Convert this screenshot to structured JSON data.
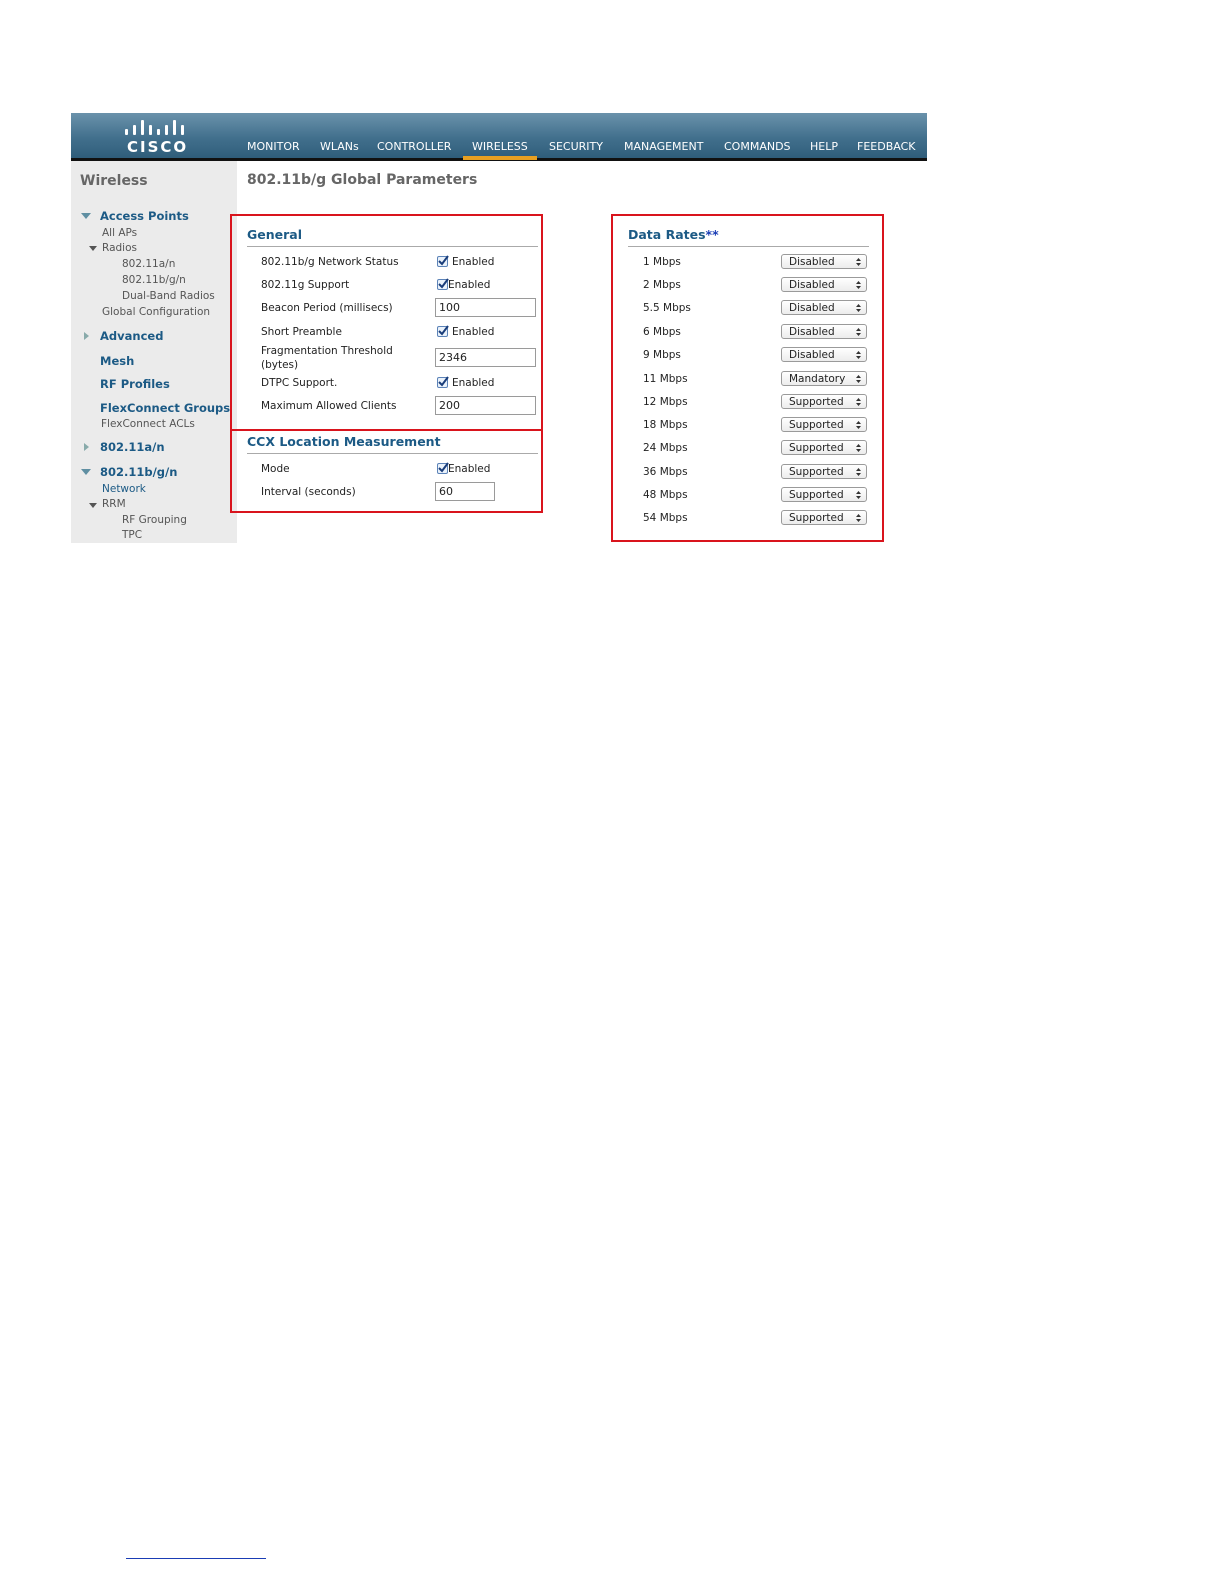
{
  "header": {
    "logo_text": "CISCO",
    "nav": [
      "MONITOR",
      "WLANs",
      "CONTROLLER",
      "WIRELESS",
      "SECURITY",
      "MANAGEMENT",
      "COMMANDS",
      "HELP",
      "FEEDBACK"
    ],
    "active_nav": "WIRELESS",
    "accent_color": "#e8a021"
  },
  "sidebar": {
    "title": "Wireless",
    "access_points": "Access Points",
    "all_aps": "All APs",
    "radios": "Radios",
    "radio_80211an": "802.11a/n",
    "radio_80211bgn": "802.11b/g/n",
    "dual_band": "Dual-Band Radios",
    "global_config": "Global Configuration",
    "advanced": "Advanced",
    "mesh": "Mesh",
    "rf_profiles": "RF Profiles",
    "flexconnect_groups": "FlexConnect Groups",
    "flexconnect_acls": "FlexConnect ACLs",
    "net_80211an": "802.11a/n",
    "net_80211bgn": "802.11b/g/n",
    "network": "Network",
    "rrm": "RRM",
    "rf_grouping": "RF Grouping",
    "tpc": "TPC"
  },
  "page": {
    "title": "802.11b/g Global Parameters"
  },
  "general": {
    "title": "General",
    "network_status_label": "802.11b/g Network Status",
    "network_status_checked": true,
    "network_status_text": "Enabled",
    "g_support_label": "802.11g Support",
    "g_support_checked": true,
    "g_support_text": "Enabled",
    "beacon_label": "Beacon Period (millisecs)",
    "beacon_value": "100",
    "short_preamble_label": "Short Preamble",
    "short_preamble_checked": true,
    "short_preamble_text": "Enabled",
    "frag_label_1": "Fragmentation Threshold",
    "frag_label_2": "(bytes)",
    "frag_value": "2346",
    "dtpc_label": "DTPC Support.",
    "dtpc_checked": true,
    "dtpc_text": "Enabled",
    "max_clients_label": "Maximum Allowed Clients",
    "max_clients_value": "200"
  },
  "ccx": {
    "title": "CCX Location Measurement",
    "mode_label": "Mode",
    "mode_checked": true,
    "mode_text": "Enabled",
    "interval_label": "Interval (seconds)",
    "interval_value": "60"
  },
  "data_rates": {
    "title": "Data Rates",
    "title_suffix": "**",
    "rows": [
      {
        "rate": "1 Mbps",
        "value": "Disabled"
      },
      {
        "rate": "2 Mbps",
        "value": "Disabled"
      },
      {
        "rate": "5.5 Mbps",
        "value": "Disabled"
      },
      {
        "rate": "6 Mbps",
        "value": "Disabled"
      },
      {
        "rate": "9 Mbps",
        "value": "Disabled"
      },
      {
        "rate": "11 Mbps",
        "value": "Mandatory"
      },
      {
        "rate": "12 Mbps",
        "value": "Supported"
      },
      {
        "rate": "18 Mbps",
        "value": "Supported"
      },
      {
        "rate": "24 Mbps",
        "value": "Supported"
      },
      {
        "rate": "36 Mbps",
        "value": "Supported"
      },
      {
        "rate": "48 Mbps",
        "value": "Supported"
      },
      {
        "rate": "54 Mbps",
        "value": "Supported"
      }
    ]
  }
}
